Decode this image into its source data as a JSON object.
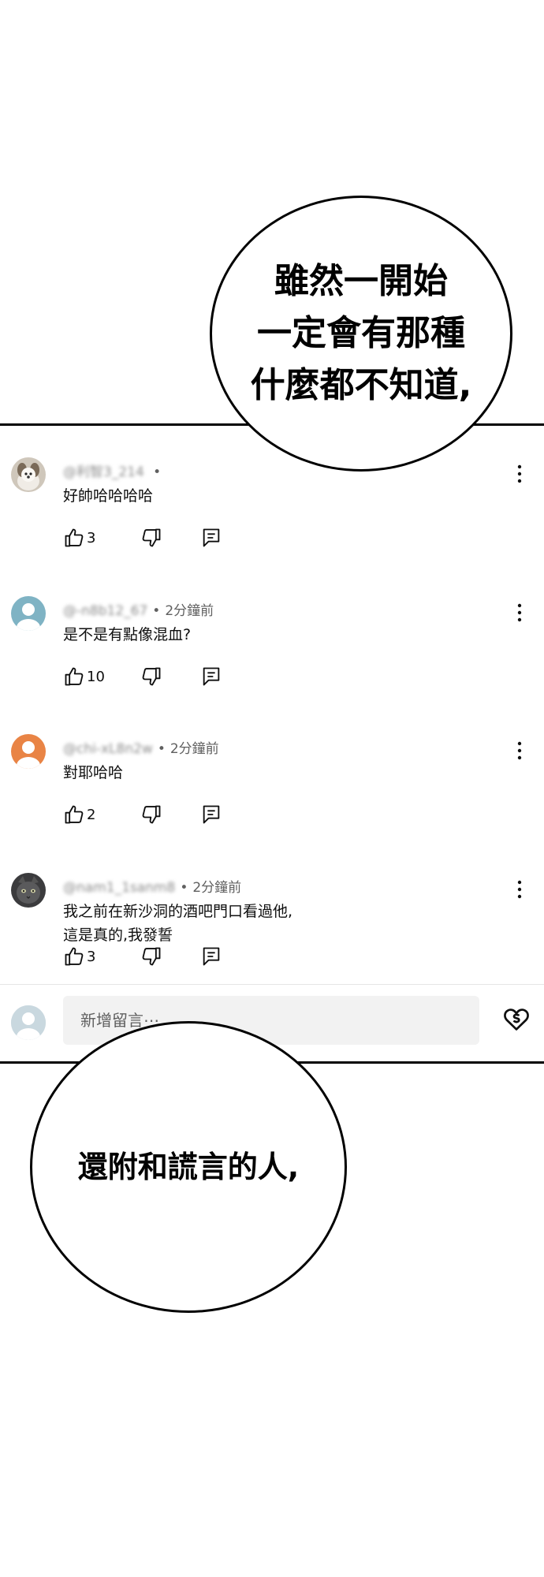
{
  "bubbles": {
    "top": "雖然一開始\n一定會有那種\n什麼都不知道,",
    "bottom": "還附和謊言的人,"
  },
  "comments": [
    {
      "handle": "@利智3_214",
      "time": "",
      "text": "好帥哈哈哈哈",
      "likes": "3",
      "avatar": "dog-photo"
    },
    {
      "handle": "@-n8b12_67",
      "time": "2分鐘前",
      "text": "是不是有點像混血?",
      "likes": "10",
      "avatar": "default-teal"
    },
    {
      "handle": "@chi-xL8n2w",
      "time": "2分鐘前",
      "text": "對耶哈哈",
      "likes": "2",
      "avatar": "default-orange"
    },
    {
      "handle": "@nam1_1sanm8",
      "time": "2分鐘前",
      "text": "我之前在新沙洞的酒吧門口看過他,\n這是真的,我發誓",
      "likes": "3",
      "avatar": "cat-photo"
    }
  ],
  "separator": "•",
  "composer": {
    "placeholder": "新增留言⋯"
  },
  "colors": {
    "teal": "#7fb3c4",
    "orange": "#e98445",
    "secondary_text": "#606060"
  }
}
